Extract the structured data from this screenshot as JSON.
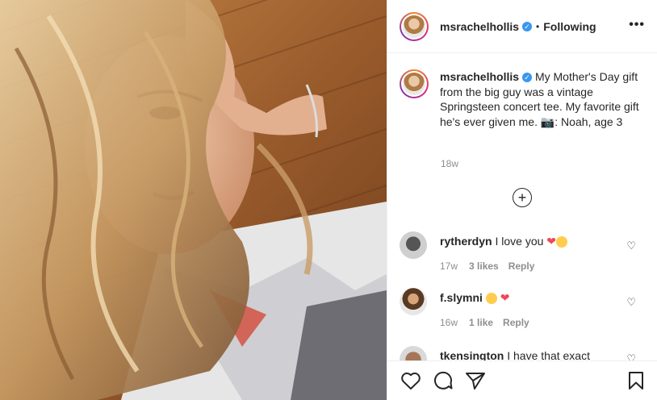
{
  "header": {
    "username": "msrachelhollis",
    "separator": "•",
    "follow_status": "Following",
    "more_label": "•••"
  },
  "caption": {
    "username": "msrachelhollis",
    "text": "My Mother's Day gift from the big guy was a vintage Springsteen concert tee. My favorite gift he's ever given me. 📷: Noah, age 3",
    "time": "18w"
  },
  "load_more_label": "+",
  "comments": [
    {
      "username": "rytherdyn",
      "text": "I love you",
      "time": "17w",
      "likes": "3 likes",
      "reply": "Reply"
    },
    {
      "username": "f.slymni",
      "text": "",
      "time": "16w",
      "likes": "1 like",
      "reply": "Reply"
    },
    {
      "username": "tkensington",
      "text": "I have that exact"
    }
  ],
  "icons": {
    "verified": "verified-badge-icon",
    "like": "heart-icon",
    "comment": "comment-icon",
    "share": "paper-plane-icon",
    "save": "bookmark-icon"
  },
  "colors": {
    "verified": "#3897f0",
    "muted": "#8e8e8e",
    "heart": "#ed4956"
  }
}
